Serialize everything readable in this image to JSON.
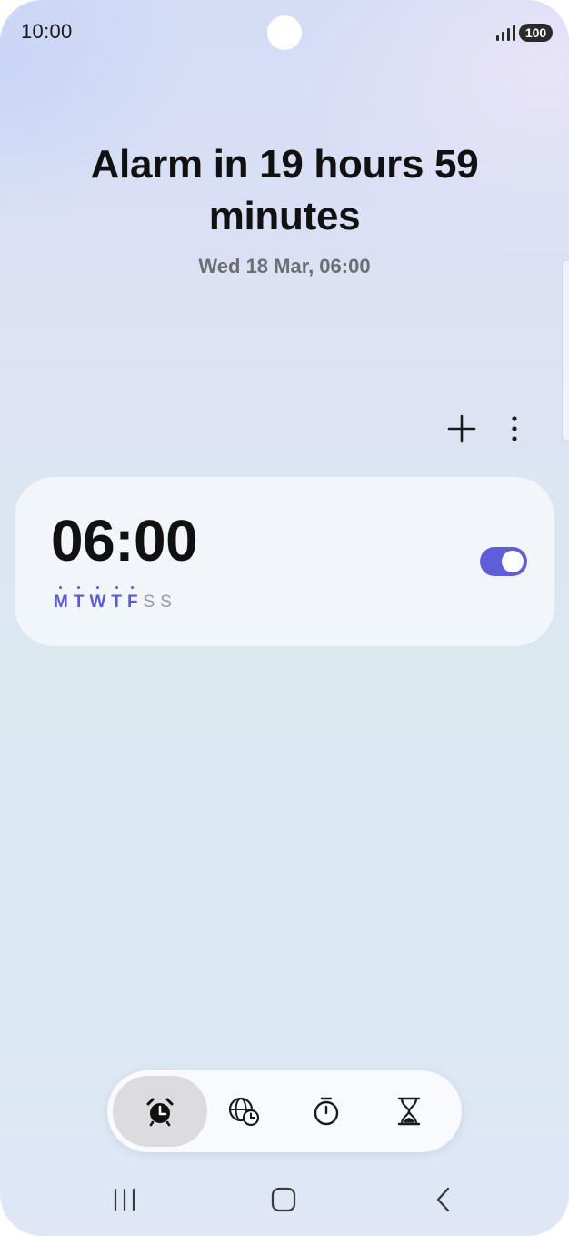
{
  "status_bar": {
    "time": "10:00",
    "battery": "100"
  },
  "header": {
    "headline": "Alarm in 19 hours 59 minutes",
    "next_alarm_date": "Wed 18 Mar, 06:00"
  },
  "toolbar": {
    "add_icon": "plus-icon",
    "more_icon": "more-vertical-icon"
  },
  "alarms": [
    {
      "time": "06:00",
      "enabled": true,
      "days": [
        {
          "label": "M",
          "active": true
        },
        {
          "label": "T",
          "active": true
        },
        {
          "label": "W",
          "active": true
        },
        {
          "label": "T",
          "active": true
        },
        {
          "label": "F",
          "active": true
        },
        {
          "label": "S",
          "active": false
        },
        {
          "label": "S",
          "active": false
        }
      ]
    }
  ],
  "tabs": [
    {
      "icon": "alarm-clock-icon",
      "selected": true
    },
    {
      "icon": "world-clock-icon",
      "selected": false
    },
    {
      "icon": "stopwatch-icon",
      "selected": false
    },
    {
      "icon": "hourglass-icon",
      "selected": false
    }
  ],
  "nav_bar": {
    "recents_icon": "recents-icon",
    "home_icon": "home-icon",
    "back_icon": "back-icon"
  },
  "colors": {
    "accent": "#5e5ed8",
    "active_day": "#5b5bd6",
    "inactive_day": "#9a9aa0"
  }
}
